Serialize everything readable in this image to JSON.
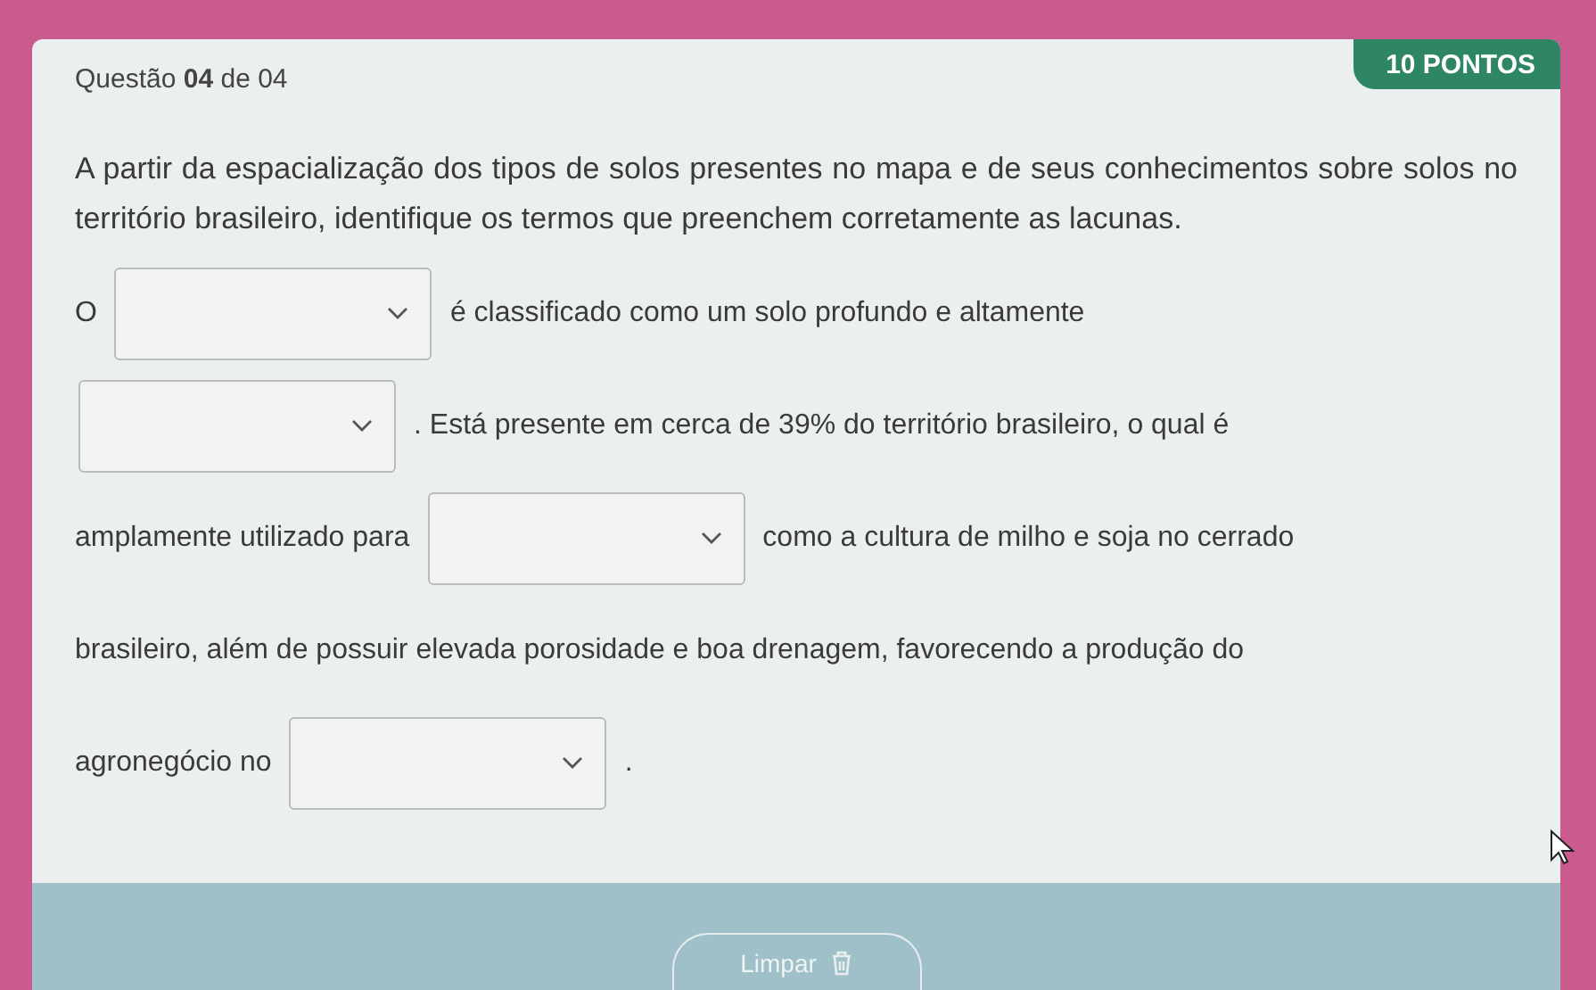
{
  "header": {
    "question": "Questão **04** de 04",
    "points": "10 PONTOS"
  },
  "prompt": "A partir da espacialização dos tipos de solos presentes no mapa e de seus conhecimentos sobre solos no território brasileiro, identifique os termos que preenchem corretamente as lacunas.",
  "lines": [
    {
      "parts": [
        {
          "kind": "text",
          "text": "O"
        },
        {
          "kind": "select"
        },
        {
          "kind": "text",
          "text": "é classificado como um solo profundo e altamente"
        }
      ]
    },
    {
      "parts": [
        {
          "kind": "select"
        },
        {
          "kind": "text",
          "text": ". Está presente em cerca de 39% do território brasileiro, o qual é"
        }
      ]
    },
    {
      "parts": [
        {
          "kind": "text",
          "text": "amplamente utilizado para"
        },
        {
          "kind": "select"
        },
        {
          "kind": "text",
          "text": "como a cultura de milho e soja no cerrado"
        }
      ]
    },
    {
      "parts": [
        {
          "kind": "text",
          "text": "brasileiro, além de possuir elevada porosidade e boa drenagem, favorecendo a produção do"
        }
      ]
    },
    {
      "parts": [
        {
          "kind": "text",
          "text": "agronegócio no"
        },
        {
          "kind": "select"
        },
        {
          "kind": "text",
          "text": "."
        }
      ]
    }
  ],
  "footer": {
    "clear_button": "Limpar"
  }
}
